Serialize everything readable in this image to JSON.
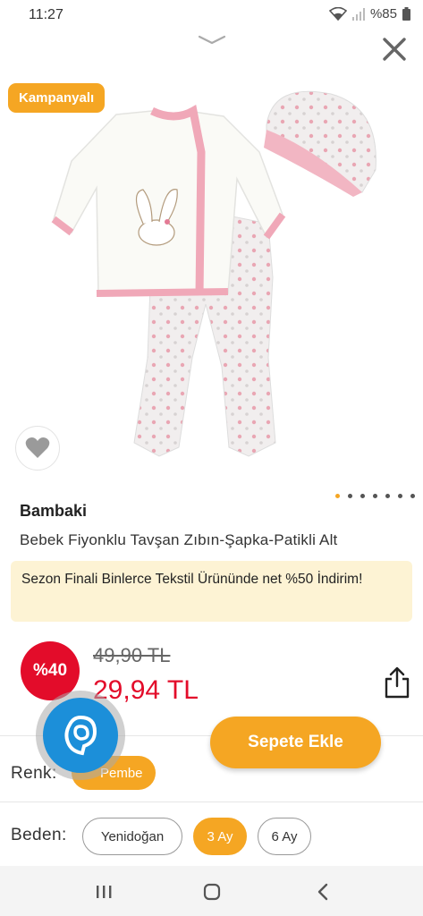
{
  "status_bar": {
    "time": "11:27",
    "battery": "%85",
    "icons": [
      "wifi-icon",
      "signal-icon",
      "battery-icon"
    ]
  },
  "header": {
    "collapse_icon": "chevron-down-icon",
    "close_icon": "close-icon"
  },
  "product": {
    "campaign_badge": "Kampanyalı",
    "brand": "Bambaki",
    "title": "Bebek Fiyonklu Tavşan Zıbın-Şapka-Patikli Alt",
    "image_count": 7,
    "active_image_index": 0
  },
  "promo": {
    "text": "Sezon Finali Binlerce Tekstil Ürününde net %50 İndirim!"
  },
  "pricing": {
    "discount_badge": "%40",
    "old_price": "49,90 TL",
    "new_price": "29,94 TL"
  },
  "color": {
    "label": "Renk:",
    "selected": "Pembe"
  },
  "cart": {
    "button_label": "Sepete Ekle"
  },
  "size": {
    "label": "Beden:",
    "options": [
      "Yenidoğan",
      "3 Ay",
      "6 Ay"
    ],
    "selected": "3 Ay"
  },
  "colors": {
    "accent": "#f5a623",
    "discount": "#e30c2a",
    "promo_bg": "#fdf3d4",
    "fab": "#1c8fd9"
  }
}
